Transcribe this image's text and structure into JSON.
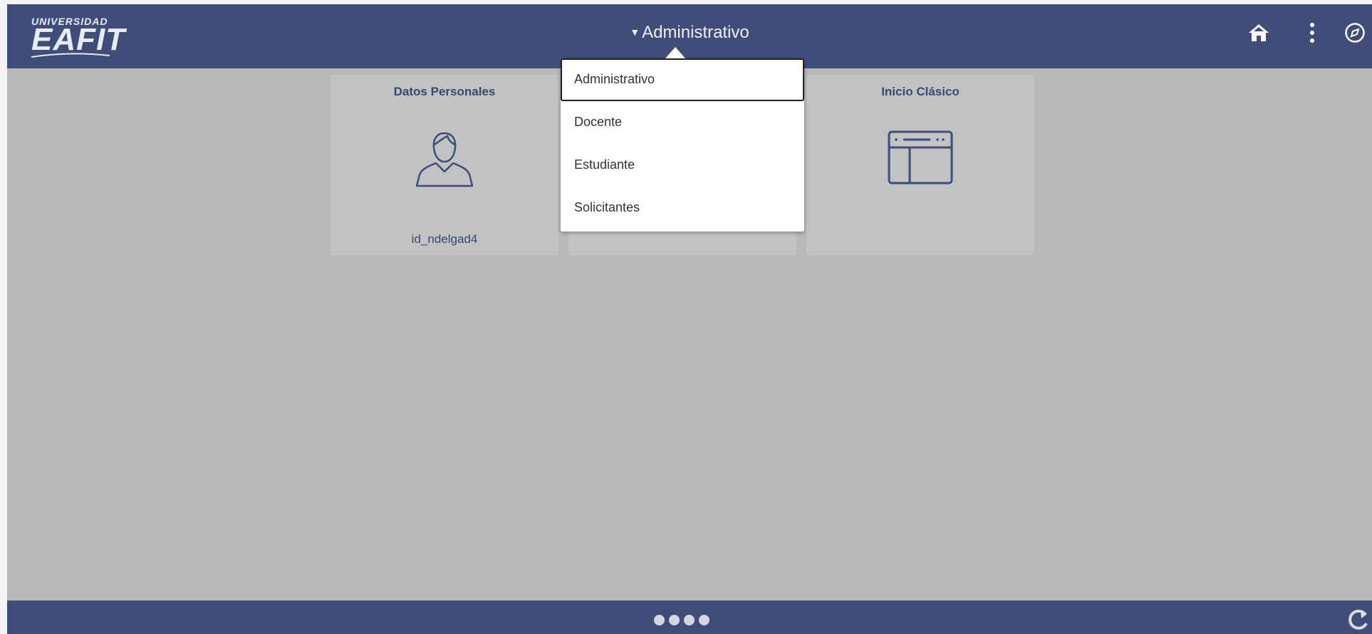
{
  "logo": {
    "line1": "UNIVERSIDAD",
    "line2": "EAFIT"
  },
  "header": {
    "context_label": "Administrativo",
    "home_icon": "home-icon",
    "actions_icon": "more-vertical-icon",
    "navbar_icon": "compass-icon"
  },
  "tiles": [
    {
      "title": "Datos Personales",
      "subtitle": "id_ndelgad4",
      "icon": "person-icon"
    },
    {
      "title": "",
      "subtitle": "",
      "icon": ""
    },
    {
      "title": "Inicio Clásico",
      "subtitle": "",
      "icon": "classic-page-icon"
    }
  ],
  "dropdown": {
    "items": [
      {
        "label": "Administrativo",
        "selected": true
      },
      {
        "label": "Docente",
        "selected": false
      },
      {
        "label": "Estudiante",
        "selected": false
      },
      {
        "label": "Solicitantes",
        "selected": false
      }
    ]
  },
  "footer": {
    "page_count": 4,
    "refresh_icon": "refresh-icon"
  },
  "colors": {
    "header_bg": "#3f4d78",
    "content_bg": "#b8b8b8",
    "tile_bg": "#c2c2c2",
    "accent_text": "#3a4870"
  }
}
